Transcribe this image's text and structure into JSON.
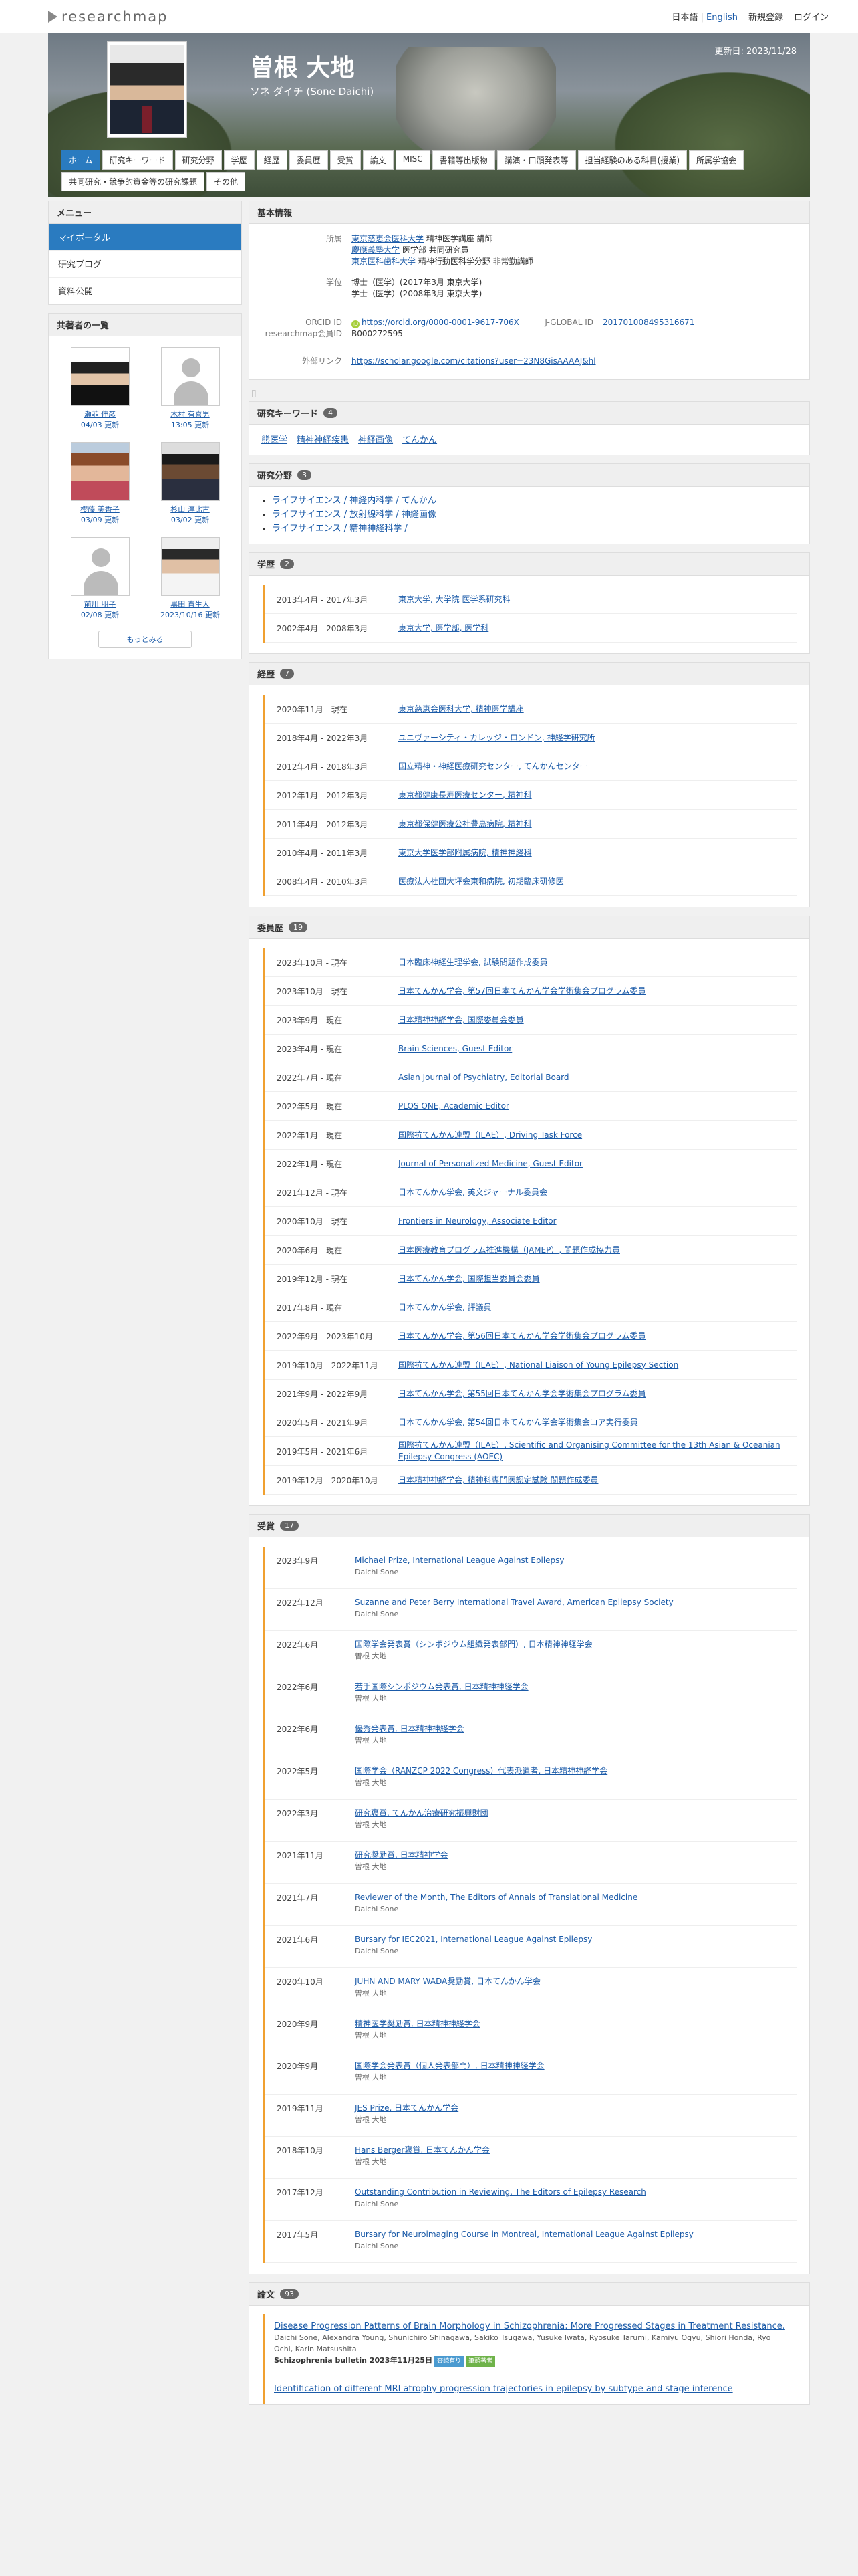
{
  "topbar": {
    "logo": "researchmap",
    "lang_ja": "日本語",
    "lang_sep": "|",
    "lang_en": "English",
    "signup": "新規登録",
    "login": "ログイン"
  },
  "profile": {
    "name": "曽根 大地",
    "kana": "ソネ ダイチ  (Sone Daichi)",
    "updated": "更新日: 2023/11/28"
  },
  "tabs": [
    "ホーム",
    "研究キーワード",
    "研究分野",
    "学歴",
    "経歴",
    "委員歴",
    "受賞",
    "論文",
    "MISC",
    "書籍等出版物",
    "講演・口頭発表等",
    "担当経験のある科目(授業)",
    "所属学協会",
    "共同研究・競争的資金等の研究課題",
    "その他"
  ],
  "menu": {
    "title": "メニュー",
    "items": [
      "マイポータル",
      "研究ブログ",
      "資料公開"
    ]
  },
  "coauthors": {
    "title": "共著者の一覧",
    "more": "もっとみる",
    "items": [
      {
        "name": "瀬韮 伸彦",
        "date": "04/03 更新"
      },
      {
        "name": "木村 有喜男",
        "date": "13:05 更新"
      },
      {
        "name": "櫻藤 美香子",
        "date": "03/09 更新"
      },
      {
        "name": "杉山 淳比古",
        "date": "03/02 更新"
      },
      {
        "name": "前川 朋子",
        "date": "02/08 更新"
      },
      {
        "name": "黒田 直生人",
        "date": "2023/10/16 更新"
      }
    ]
  },
  "basic": {
    "title": "基本情報",
    "affil_label": "所属",
    "affil": [
      {
        "org": "東京慈恵会医科大学",
        "rest": " 精神医学講座 講師"
      },
      {
        "org": "慶應義塾大学",
        "rest": " 医学部 共同研究員"
      },
      {
        "org": "東京医科歯科大学",
        "rest": " 精神行動医科学分野 非常勤講師"
      }
    ],
    "degree_label": "学位",
    "degrees": [
      "博士（医学）(2017年3月 東京大学)",
      "学士（医学）(2008年3月 東京大学)"
    ],
    "orcid_label": "ORCID ID",
    "orcid": "https://orcid.org/0000-0001-9617-706X",
    "jglobal_label": "J-GLOBAL ID",
    "jglobal": "201701008495316671",
    "rm_label": "researchmap会員ID",
    "rm_id": "B000272595",
    "ext_label": "外部リンク",
    "ext": "https://scholar.google.com/citations?user=23N8GisAAAAJ&hl"
  },
  "keywords": {
    "title": "研究キーワード",
    "count": "4",
    "items": [
      "熊医学",
      "精神神経疾患",
      "神経画像",
      "てんかん"
    ]
  },
  "fields": {
    "title": "研究分野",
    "count": "3",
    "items": [
      "ライフサイエンス / 神経内科学 / てんかん",
      "ライフサイエンス / 放射線科学 / 神経画像",
      "ライフサイエンス / 精神神経科学 /"
    ]
  },
  "education": {
    "title": "学歴",
    "count": "2",
    "items": [
      {
        "d": "2013年4月 - 2017年3月",
        "t": "東京大学, 大学院 医学系研究科"
      },
      {
        "d": "2002年4月 - 2008年3月",
        "t": "東京大学, 医学部, 医学科"
      }
    ]
  },
  "career": {
    "title": "経歴",
    "count": "7",
    "items": [
      {
        "d": "2020年11月 - 現在",
        "t": "東京慈恵会医科大学, 精神医学講座"
      },
      {
        "d": "2018年4月 - 2022年3月",
        "t": "ユニヴァーシティ・カレッジ・ロンドン, 神経学研究所"
      },
      {
        "d": "2012年4月 - 2018年3月",
        "t": "国立精神・神経医療研究センター, てんかんセンター"
      },
      {
        "d": "2012年1月 - 2012年3月",
        "t": "東京都健康長寿医療センター, 精神科"
      },
      {
        "d": "2011年4月 - 2012年3月",
        "t": "東京都保健医療公社豊島病院, 精神科"
      },
      {
        "d": "2010年4月 - 2011年3月",
        "t": "東京大学医学部附属病院, 精神神経科"
      },
      {
        "d": "2008年4月 - 2010年3月",
        "t": "医療法人社団大坪会東和病院, 初期臨床研修医"
      }
    ]
  },
  "committee": {
    "title": "委員歴",
    "count": "19",
    "items": [
      {
        "d": "2023年10月 - 現在",
        "t": "日本臨床神経生理学会, 試験問題作成委員"
      },
      {
        "d": "2023年10月 - 現在",
        "t": "日本てんかん学会, 第57回日本てんかん学会学術集会プログラム委員"
      },
      {
        "d": "2023年9月 - 現在",
        "t": "日本精神神経学会, 国際委員会委員"
      },
      {
        "d": "2023年4月 - 現在",
        "t": "Brain Sciences, Guest Editor"
      },
      {
        "d": "2022年7月 - 現在",
        "t": "Asian Journal of Psychiatry, Editorial Board"
      },
      {
        "d": "2022年5月 - 現在",
        "t": "PLOS ONE, Academic Editor"
      },
      {
        "d": "2022年1月 - 現在",
        "t": "国際抗てんかん連盟（ILAE）, Driving Task Force"
      },
      {
        "d": "2022年1月 - 現在",
        "t": "Journal of Personalized Medicine, Guest Editor"
      },
      {
        "d": "2021年12月 - 現在",
        "t": "日本てんかん学会, 英文ジャーナル委員会"
      },
      {
        "d": "2020年10月 - 現在",
        "t": "Frontiers in Neurology, Associate Editor"
      },
      {
        "d": "2020年6月 - 現在",
        "t": "日本医療教育プログラム推進機構（JAMEP）, 問題作成協力員"
      },
      {
        "d": "2019年12月 - 現在",
        "t": "日本てんかん学会, 国際担当委員会委員"
      },
      {
        "d": "2017年8月 - 現在",
        "t": "日本てんかん学会, 評議員"
      },
      {
        "d": "2022年9月 - 2023年10月",
        "t": "日本てんかん学会, 第56回日本てんかん学会学術集会プログラム委員"
      },
      {
        "d": "2019年10月 - 2022年11月",
        "t": "国際抗てんかん連盟（ILAE）, National Liaison of Young Epilepsy Section"
      },
      {
        "d": "2021年9月 - 2022年9月",
        "t": "日本てんかん学会, 第55回日本てんかん学会学術集会プログラム委員"
      },
      {
        "d": "2020年5月 - 2021年9月",
        "t": "日本てんかん学会, 第54回日本てんかん学会学術集会コア実行委員"
      },
      {
        "d": "2019年5月 - 2021年6月",
        "t": "国際抗てんかん連盟（ILAE）, Scientific and Organising Committee for the 13th Asian & Oceanian Epilepsy Congress (AOEC)"
      },
      {
        "d": "2019年12月 - 2020年10月",
        "t": "日本精神神経学会, 精神科専門医認定試験 問題作成委員"
      }
    ]
  },
  "awards": {
    "title": "受賞",
    "count": "17",
    "items": [
      {
        "d": "2023年9月",
        "t": "Michael Prize, International League Against Epilepsy",
        "s": "Daichi Sone"
      },
      {
        "d": "2022年12月",
        "t": "Suzanne and Peter Berry International Travel Award, American Epilepsy Society",
        "s": "Daichi Sone"
      },
      {
        "d": "2022年6月",
        "t": "国際学会発表賞（シンポジウム組織発表部門）, 日本精神神経学会",
        "s": "曽根 大地"
      },
      {
        "d": "2022年6月",
        "t": "若手国際シンポジウム発表賞, 日本精神神経学会",
        "s": "曽根 大地"
      },
      {
        "d": "2022年6月",
        "t": "優秀発表賞, 日本精神神経学会",
        "s": "曽根 大地"
      },
      {
        "d": "2022年5月",
        "t": "国際学会（RANZCP 2022 Congress）代表派遣者, 日本精神神経学会",
        "s": "曽根 大地"
      },
      {
        "d": "2022年3月",
        "t": "研究褒賞, てんかん治療研究振興財団",
        "s": "曽根 大地"
      },
      {
        "d": "2021年11月",
        "t": "研究奨励賞, 日本精神学会",
        "s": "曽根 大地"
      },
      {
        "d": "2021年7月",
        "t": "Reviewer of the Month, The Editors of Annals of Translational Medicine",
        "s": "Daichi Sone"
      },
      {
        "d": "2021年6月",
        "t": "Bursary for IEC2021, International League Against Epilepsy",
        "s": "Daichi Sone"
      },
      {
        "d": "2020年10月",
        "t": "JUHN AND MARY WADA奨励賞, 日本てんかん学会",
        "s": "曽根 大地"
      },
      {
        "d": "2020年9月",
        "t": "精神医学奨励賞, 日本精神神経学会",
        "s": "曽根 大地"
      },
      {
        "d": "2020年9月",
        "t": "国際学会発表賞（個人発表部門）, 日本精神神経学会",
        "s": "曽根 大地"
      },
      {
        "d": "2019年11月",
        "t": "JES Prize, 日本てんかん学会",
        "s": "曽根 大地"
      },
      {
        "d": "2018年10月",
        "t": "Hans Berger褒賞, 日本てんかん学会",
        "s": "曽根 大地"
      },
      {
        "d": "2017年12月",
        "t": "Outstanding Contribution in Reviewing, The Editors of Epilepsy Research",
        "s": "Daichi Sone"
      },
      {
        "d": "2017年5月",
        "t": "Bursary for Neuroimaging Course in Montreal, International League Against Epilepsy",
        "s": "Daichi Sone"
      }
    ]
  },
  "papers": {
    "title": "論文",
    "count": "93",
    "items": [
      {
        "t": "Disease Progression Patterns of Brain Morphology in Schizophrenia: More Progressed Stages in Treatment Resistance.",
        "a": "Daichi Sone, Alexandra Young, Shunichiro Shinagawa, Sakiko Tsugawa, Yusuke Iwata, Ryosuke Tarumi, Kamiyu Ogyu, Shiori Honda, Ryo Ochi, Karin Matsushita",
        "src": "Schizophrenia bulletin 2023年11月25日",
        "tag1": "査読有り",
        "tag2": "筆頭著者"
      },
      {
        "t": "Identification of different MRI atrophy progression trajectories in epilepsy by subtype and stage inference",
        "a": "",
        "src": "",
        "tag1": "",
        "tag2": ""
      }
    ]
  }
}
